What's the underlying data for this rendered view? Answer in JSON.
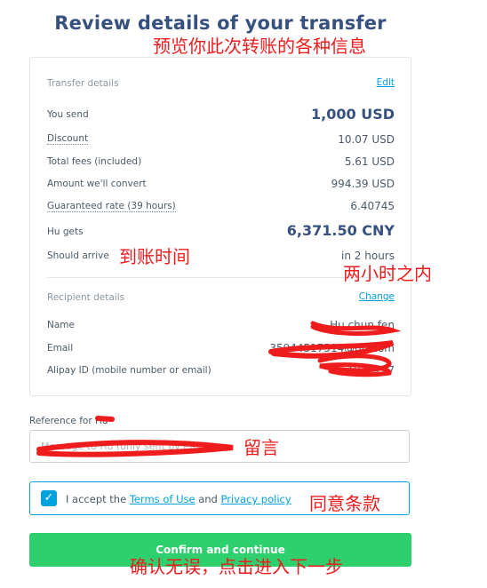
{
  "page": {
    "title": "Review details of your transfer"
  },
  "transfer": {
    "section_title": "Transfer details",
    "edit_label": "Edit",
    "rows": [
      {
        "label": "You send",
        "value": "1,000 USD"
      },
      {
        "label": "Discount",
        "value": "10.07 USD"
      },
      {
        "label": "Total fees (included)",
        "value": "5.61 USD"
      },
      {
        "label": "Amount we'll convert",
        "value": "994.39 USD"
      },
      {
        "label": "Guaranteed rate (39 hours)",
        "value": "6.40745"
      },
      {
        "label": "Hu gets",
        "value": "6,371.50 CNY"
      },
      {
        "label": "Should arrive",
        "value": "in 2 hours"
      }
    ]
  },
  "recipient": {
    "section_title": "Recipient details",
    "change_label": "Change",
    "rows": [
      {
        "label": "Name",
        "value": "Hu chun fen"
      },
      {
        "label": "Email",
        "value": "35944517514@qq.com"
      },
      {
        "label": "Alipay ID (mobile number or email)",
        "value": "1911157"
      }
    ]
  },
  "reference": {
    "label": "Reference for Hu",
    "placeholder": "Message to Hu (only sent by email)"
  },
  "terms": {
    "prefix": "I accept the ",
    "terms_link": "Terms of Use",
    "middle": " and ",
    "privacy_link": "Privacy policy",
    "checked": true
  },
  "confirm_label": "Confirm and continue",
  "annotations": {
    "preview": "预览你此次转账的各种信息",
    "arrival": "到账时间",
    "two_hours": "两小时之内",
    "message": "留言",
    "agree": "同意条款",
    "confirm": "确认无误，点击进入下一步"
  },
  "colors": {
    "accent": "#00a2dd",
    "confirm": "#2ed06e",
    "title": "#37517e",
    "annotation": "#ee1c1c"
  }
}
